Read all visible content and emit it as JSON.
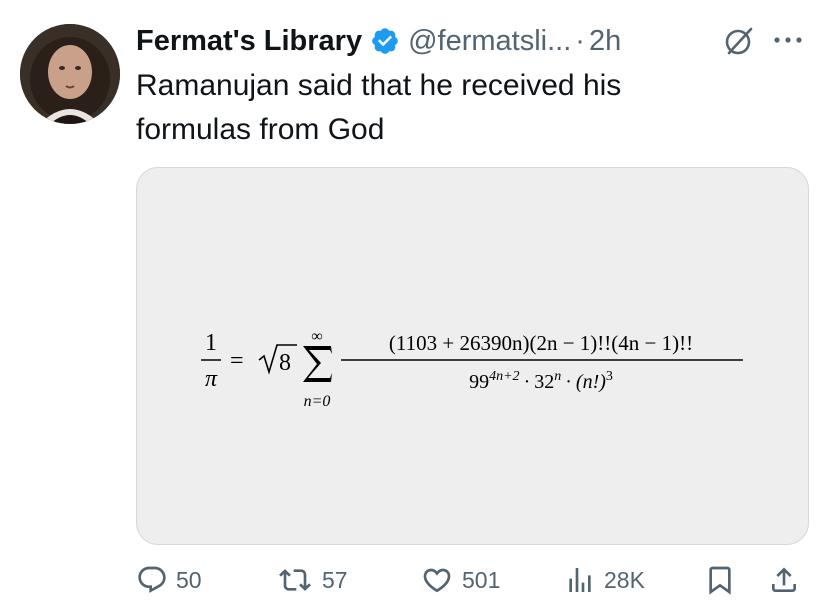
{
  "author": {
    "name": "Fermat's Library",
    "handle": "@fermatsli...",
    "separator": "·",
    "time": "2h"
  },
  "tweet": {
    "text": "Ramanujan said that he received his formulas from God"
  },
  "formula": {
    "lhs_num": "1",
    "lhs_den": "π",
    "equals": "=",
    "sqrt_arg": "8",
    "sum_upper": "∞",
    "sum_lower": "n=0",
    "numerator": "(1103 + 26390n)(2n − 1)!!(4n − 1)!!",
    "den_base1": "99",
    "den_exp1": "4n+2",
    "den_dot1": "·",
    "den_base2": "32",
    "den_exp2": "n",
    "den_dot2": "·",
    "den_base3": "(n!)",
    "den_exp3": "3"
  },
  "actions": {
    "replies": "50",
    "retweets": "57",
    "likes": "501",
    "views": "28K"
  },
  "icons": [
    "avatar",
    "verified-badge-icon",
    "grok-icon",
    "more-icon",
    "reply-icon",
    "retweet-icon",
    "like-icon",
    "views-icon",
    "bookmark-icon",
    "share-icon"
  ],
  "colors": {
    "verified": "#1d9bf0",
    "secondary_text": "#536471",
    "primary_text": "#0f1419",
    "media_bg": "#eeeeee"
  }
}
